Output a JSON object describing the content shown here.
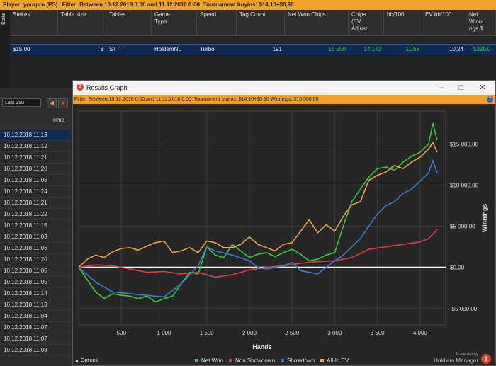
{
  "topbar": {
    "player_label": "Player:",
    "player": "yourpro (PS)",
    "filter_label": "Filter:",
    "filter": "Between 10.12.2018 0:00 and 11.12.2018 0:00; Tournament buyins: $14,10+$0,90"
  },
  "sidetab": {
    "label": "Stats"
  },
  "stats": {
    "columns": [
      [
        "Stakes"
      ],
      [
        "Table size"
      ],
      [
        "Tables"
      ],
      [
        "Game",
        "Type"
      ],
      [
        "Speed"
      ],
      [
        "Tag Count"
      ],
      [
        "Net Won Chips"
      ],
      [
        "Chips",
        "(EV",
        "Adjust"
      ],
      [
        "bb/100"
      ],
      [
        "EV bb/100"
      ],
      [
        "Net",
        "Winni",
        "ngs $"
      ]
    ],
    "row": {
      "stakes": "$15,00",
      "table_size": "3",
      "tables": "STT",
      "game_type": "HoldemNL",
      "speed": "Turbo",
      "tag_count": "191",
      "net_won_chips": "15 500",
      "chips_ev": "14 172",
      "bb100": "11,58",
      "ev_bb100": "10,24",
      "net_winnings": "$225,0"
    }
  },
  "left": {
    "session_select": "Last 250",
    "time_header": "Time",
    "times": [
      "10.12.2018 11:13",
      "10.12.2018 11:12",
      "10.12.2018 11:21",
      "10.12.2018 11:20",
      "10.12.2018 11:06",
      "10.12.2018 11:24",
      "10.12.2018 11:21",
      "10.12.2018 11:22",
      "10.12.2018 11:15",
      "10.12.2018 11:03",
      "10.12.2018 11:06",
      "10.12.2018 11:20",
      "10.12.2018 11:05",
      "10.12.2018 11:05",
      "10.12.2018 11:14",
      "10.12.2018 11:13",
      "10.12.2018 11:04",
      "10.12.2018 11:07",
      "10.12.2018 11:07",
      "10.12.2018 11:08"
    ]
  },
  "window": {
    "title": "Results Graph",
    "filter_label": "Filter:",
    "filter": "Between 10.12.2018 0:00 and 11.12.2018 0:00; Tournament buyins: $14,10+$0,90",
    "winnings_label": "Winnings:",
    "winnings": "$15 500,00",
    "options_label": "Options",
    "powered_by": "Powered by",
    "brand": "Hold'em Manager",
    "brand_badge": "2"
  },
  "chart_data": {
    "type": "line",
    "xlabel": "Hands",
    "ylabel": "Winnings",
    "xlim": [
      0,
      4300
    ],
    "ylim": [
      -7000,
      19000
    ],
    "x_ticks": [
      500,
      1000,
      1500,
      2000,
      2500,
      3000,
      3500,
      4000
    ],
    "x_tick_labels": [
      "500",
      "1 000",
      "1 500",
      "2 000",
      "2 500",
      "3 000",
      "3 500",
      "4 000"
    ],
    "y_ticks": [
      -5000,
      0,
      5000,
      10000,
      15000
    ],
    "y_tick_labels": [
      "-$5 000,00",
      "$0,00",
      "$5 000,00",
      "$10 000,00",
      "$15 000,00"
    ],
    "grid": true,
    "legend_position": "bottom",
    "series": [
      {
        "name": "Net Won",
        "color": "#33cc33",
        "x": [
          0,
          100,
          200,
          300,
          400,
          500,
          600,
          700,
          800,
          900,
          1000,
          1100,
          1200,
          1300,
          1400,
          1500,
          1600,
          1700,
          1800,
          1900,
          2000,
          2100,
          2200,
          2300,
          2400,
          2500,
          2600,
          2700,
          2800,
          2900,
          3000,
          3100,
          3200,
          3300,
          3400,
          3500,
          3600,
          3700,
          3800,
          3900,
          4000,
          4100,
          4150,
          4200
        ],
        "y": [
          0,
          -1500,
          -3000,
          -3800,
          -3200,
          -3400,
          -3500,
          -3800,
          -3500,
          -4200,
          -3800,
          -3500,
          -2000,
          -600,
          -800,
          2500,
          1500,
          1200,
          2800,
          2000,
          1200,
          1600,
          1800,
          1300,
          1800,
          2200,
          1600,
          800,
          1000,
          1500,
          1800,
          5000,
          8000,
          9500,
          11000,
          12000,
          12200,
          11800,
          12800,
          13500,
          14000,
          15000,
          17500,
          15500
        ]
      },
      {
        "name": "Non Showdown",
        "color": "#e04040",
        "x": [
          0,
          200,
          400,
          600,
          800,
          1000,
          1200,
          1400,
          1600,
          1800,
          2000,
          2200,
          2400,
          2600,
          2800,
          3000,
          3200,
          3400,
          3600,
          3800,
          4000,
          4100,
          4200
        ],
        "y": [
          0,
          300,
          200,
          -200,
          -600,
          -500,
          -800,
          -600,
          -1200,
          -900,
          -300,
          0,
          200,
          500,
          700,
          800,
          1200,
          2200,
          2500,
          2800,
          3100,
          3500,
          4600
        ]
      },
      {
        "name": "Showdown",
        "color": "#3a7fd0",
        "x": [
          0,
          200,
          400,
          600,
          800,
          1000,
          1200,
          1400,
          1500,
          1600,
          1800,
          2000,
          2100,
          2200,
          2400,
          2500,
          2600,
          2800,
          2900,
          3000,
          3100,
          3200,
          3300,
          3400,
          3500,
          3600,
          3700,
          3800,
          3900,
          4000,
          4100,
          4150,
          4200
        ],
        "y": [
          0,
          -1800,
          -3000,
          -3200,
          -3400,
          -3600,
          -2000,
          200,
          2500,
          2000,
          1500,
          800,
          0,
          -200,
          200,
          600,
          -400,
          -800,
          0,
          800,
          1500,
          2500,
          3500,
          5000,
          6500,
          7500,
          8000,
          9000,
          9500,
          10500,
          11500,
          13000,
          11500
        ]
      },
      {
        "name": "All-In EV",
        "color": "#f0a040",
        "x": [
          0,
          100,
          200,
          300,
          400,
          500,
          600,
          700,
          800,
          900,
          1000,
          1100,
          1200,
          1300,
          1400,
          1500,
          1600,
          1700,
          1800,
          1900,
          2000,
          2100,
          2200,
          2300,
          2400,
          2500,
          2600,
          2700,
          2800,
          2900,
          3000,
          3100,
          3200,
          3300,
          3400,
          3500,
          3600,
          3700,
          3800,
          3900,
          4000,
          4100,
          4150,
          4200
        ],
        "y": [
          0,
          1000,
          1500,
          1200,
          1900,
          2300,
          2400,
          2100,
          2600,
          3000,
          3200,
          1800,
          2000,
          2400,
          1800,
          3200,
          3000,
          2400,
          2400,
          2800,
          3700,
          2800,
          2400,
          2000,
          2800,
          3000,
          4400,
          5800,
          4200,
          5200,
          4400,
          6200,
          7600,
          8000,
          10600,
          11200,
          11600,
          12400,
          12000,
          12800,
          13400,
          14400,
          15200,
          14000
        ]
      }
    ]
  }
}
